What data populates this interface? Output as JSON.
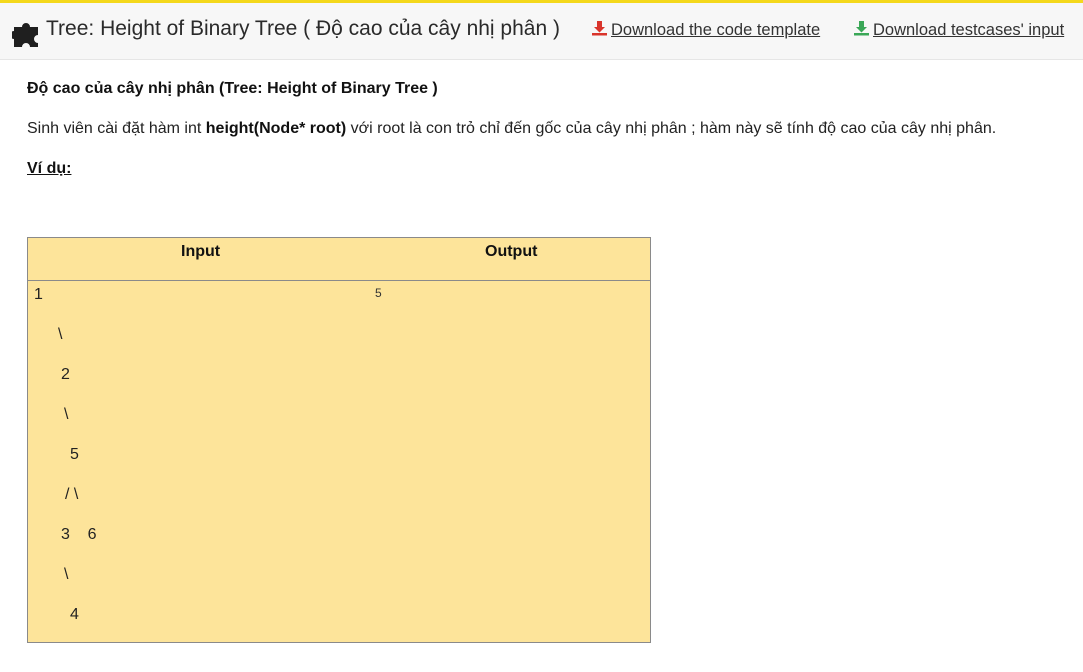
{
  "header": {
    "icon": "puzzle-piece-icon",
    "title": "Tree: Height of Binary Tree  ( Độ cao của cây nhị phân )",
    "download_template": {
      "label": "Download the code template",
      "icon": "download-icon",
      "icon_color": "#d9342b"
    },
    "download_testcases": {
      "label": "Download testcases' input",
      "icon": "download-icon",
      "icon_color": "#3aa757"
    },
    "accent_color": "#f4d81c"
  },
  "problem": {
    "heading": "Độ cao của cây nhị phân (Tree: Height of Binary Tree  )",
    "description_prefix": "Sinh viên cài đặt hàm int ",
    "description_bold": "height(Node* root)",
    "description_suffix": " với root là con trỏ chỉ đến gốc của cây nhị phân ; hàm này sẽ tính độ cao của cây nhị phân.",
    "example_label": "Ví dụ:"
  },
  "example_table": {
    "headers": [
      "Input",
      "Output"
    ],
    "input_lines": [
      "1",
      "\\",
      "2",
      "\\",
      "5",
      "/ \\",
      "3    6",
      "\\",
      "4"
    ],
    "output": "5",
    "background": "#fde49a"
  }
}
